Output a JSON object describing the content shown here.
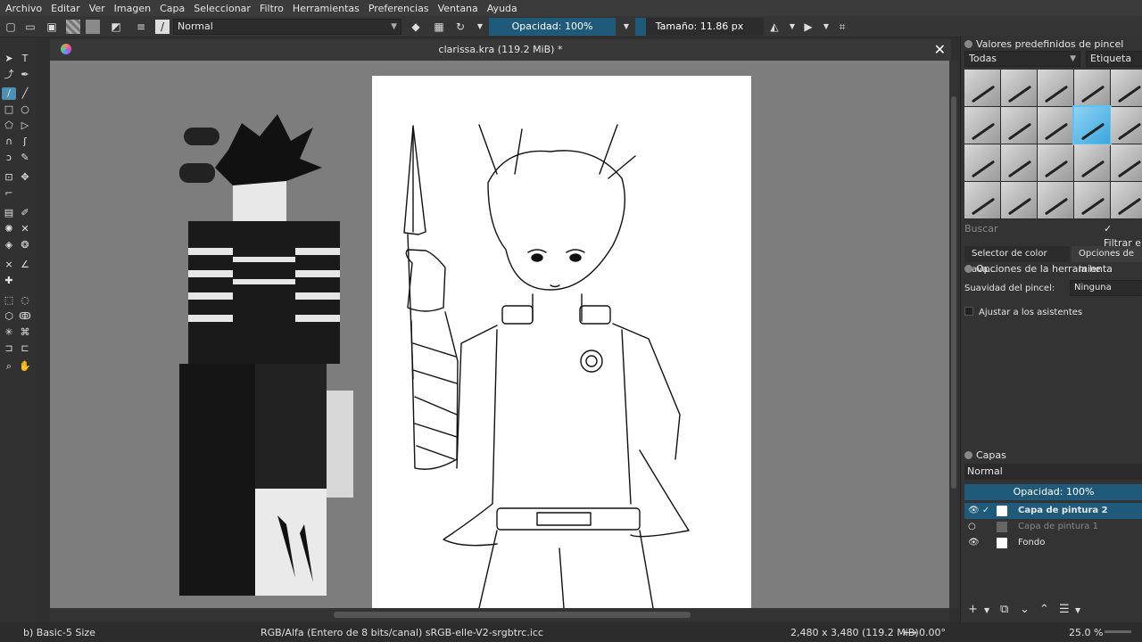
{
  "menu": [
    "Archivo",
    "Editar",
    "Ver",
    "Imagen",
    "Capa",
    "Seleccionar",
    "Filtro",
    "Herramientas",
    "Preferencias",
    "Ventana",
    "Ayuda"
  ],
  "toolbar": {
    "blend_mode": "Normal",
    "opacity_label": "Opacidad: 100%",
    "opacity": 1.0,
    "size_label": "Tamaño: 11.86 px",
    "size_fill": 0.08
  },
  "document": {
    "title": "clarissa.kra (119.2 MiB) *"
  },
  "status": {
    "brush": "b) Basic-5 Size",
    "color_space": "RGB/Alfa (Entero de 8 bits/canal)  sRGB-elle-V2-srgbtrc.icc",
    "dimensions": "2,480 x 3,480 (119.2 MiB)",
    "rotation": "0.00°",
    "zoom": "25.0 %"
  },
  "dock": {
    "presets_title": "Valores predefinidos de pincel",
    "filter_combo": "Todas",
    "tag_label": "Etiqueta",
    "search_placeholder": "Buscar",
    "filter_label": "Filtrar e",
    "tab_color": "Selector de color ava...",
    "tab_options": "Opciones de la he",
    "tool_options_title": "Opciones de la herramienta",
    "smoothing_label": "Suavidad del pincel:",
    "smoothing_value": "Ninguna",
    "assistants_label": "Ajustar a los asistentes",
    "layers_title": "Capas",
    "layers_blend": "Normal",
    "layers_opacity": "Opacidad:  100%",
    "layers": [
      {
        "name": "Capa de pintura 2",
        "selected": true
      },
      {
        "name": "Capa de pintura 1",
        "selected": false
      },
      {
        "name": "Fondo",
        "selected": false
      }
    ]
  }
}
